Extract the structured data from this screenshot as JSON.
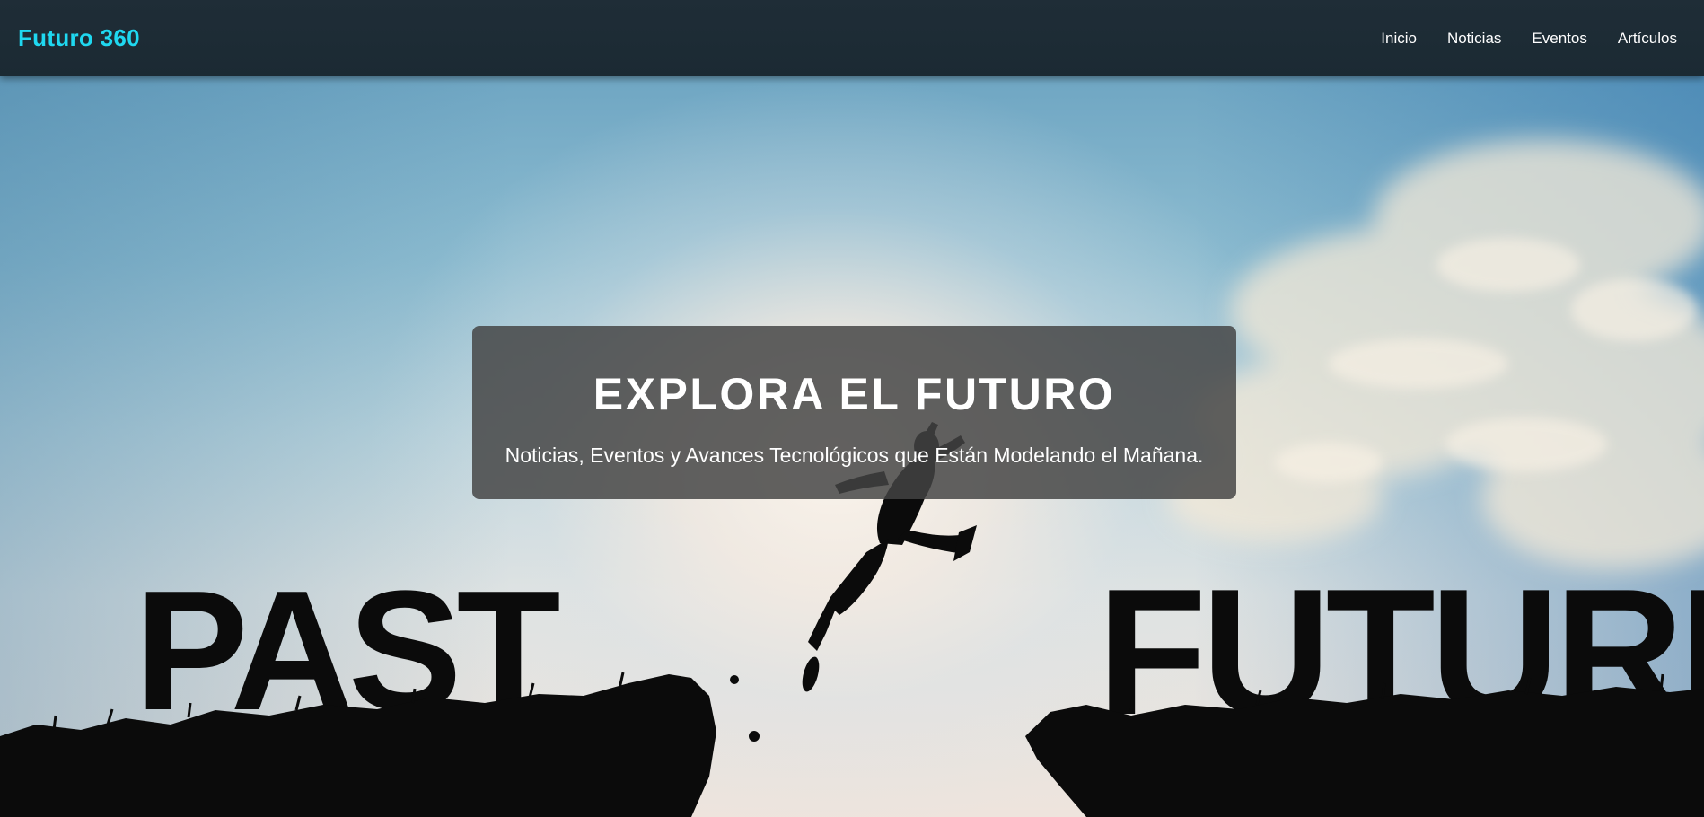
{
  "nav": {
    "brand": "Futuro 360",
    "links": [
      "Inicio",
      "Noticias",
      "Eventos",
      "Artículos"
    ]
  },
  "hero": {
    "title": "EXPLORA EL FUTURO",
    "subtitle": "Noticias, Eventos y Avances Tecnológicos que Están Modelando el Mañana.",
    "image_words": [
      "PAST",
      "FUTURE"
    ]
  },
  "colors": {
    "navbar": "#1f2d37",
    "brand": "#1fd8f0",
    "nav_text": "#ffffff",
    "overlay": "rgba(68,68,68,0.84)"
  }
}
